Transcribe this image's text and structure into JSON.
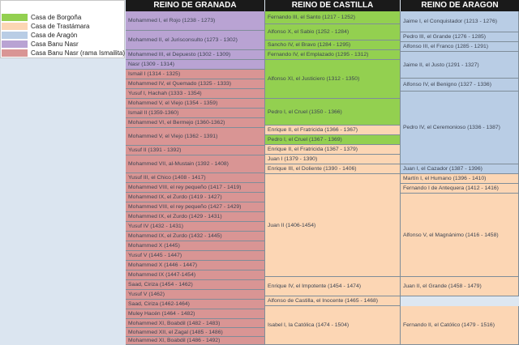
{
  "colors": {
    "borgona": "#93d050",
    "trastamara": "#fcd6b4",
    "aragon": "#b9cde5",
    "banu_nasr": "#b9a3d3",
    "banu_nasr_ismail": "#d99594"
  },
  "legend": [
    {
      "label": "Casa de Borgoña",
      "color": "#93d050"
    },
    {
      "label": "Casa de Trastámara",
      "color": "#fcd6b4"
    },
    {
      "label": "Casa de Aragón",
      "color": "#b9cde5"
    },
    {
      "label": "Casa Banu Nasr",
      "color": "#b9a3d3"
    },
    {
      "label": "Casa Banu Nasr (rama Ismailita)",
      "color": "#d99594"
    }
  ],
  "headers": {
    "granada": "REINO DE GRANADA",
    "castilla": "REINO DE CASTILLA",
    "aragon": "REINO DE ARAGON"
  },
  "granada": [
    "Mohammed I, el Rojo (1238 - 1273)",
    "Mohammed II, el Jurisconsulto (1273 - 1302)",
    "Mohammed III, el Depuesto (1302 - 1309)",
    "Nasr (1309 - 1314)",
    "Ismail I (1314 - 1325)",
    "Mohammed IV, el Quemado (1325 - 1333)",
    "Yusuf I, Hachah (1333 - 1354)",
    "Mohammed V, el Viejo (1354 - 1359)",
    "Ismail II (1359-1360)",
    "Mohammed VI, el Bermejo (1360-1362)",
    "Mohammed V, el Viejo (1362 - 1391)",
    "Yusuf II (1391 - 1392)",
    "Mohammed VII, al-Mustain (1392 - 1408)",
    "Yusuf III, el Chico (1408 - 1417)",
    "Mohammed VIII, el rey pequeño (1417 - 1419)",
    "Mohammed IX, el Zurdo (1419 - 1427)",
    "Mohammed VIII, el rey pequeño (1427 - 1429)",
    "Mohammed IX, el Zurdo (1429 - 1431)",
    "Yusuf IV (1432 - 1431)",
    "Mohammed IX, el Zurdo (1432 - 1445)",
    "Mohammed X (1445)",
    "Yusuf V (1445 - 1447)",
    "Mohammed X (1446 - 1447)",
    "Mohammed IX (1447-1454)",
    "Saad, Ciriza (1454 - 1462)",
    "Yusuf V (1462)",
    "Saad, Ciriza (1462-1464)",
    "Muley Hacén (1464 - 1482)",
    "Mohammed XI, Boabdil (1482 - 1483)",
    "Mohammed XII, el Zagal (1485 - 1486)",
    "Mohammed XI, Boabdil (1486 - 1492)"
  ],
  "castilla": [
    "Fernando III, el Santo (1217 - 1252)",
    "Alfonso X, el Sabio (1252 - 1284)",
    "Sancho IV, el Bravo (1284 - 1295)",
    "Fernando IV, el Emplazado (1295 - 1312)",
    "Alfonso XI, el Justiciero (1312 - 1350)",
    "Pedro I, el Cruel (1350 - 1366)",
    "Enrique II, el Fratricida (1366 - 1367)",
    "Pedro I, el Cruel (1367 - 1369)",
    "Enrique II, el Fratricida (1367 - 1379)",
    "Juan I (1379 - 1390)",
    "Enrique III, el Doliente (1390 - 1406)",
    "Juan II (1406-1454)",
    "Enrique IV, el Impotente (1454 - 1474)",
    "Alfonso de Castilla, el Inocente (1465 - 1468)",
    "Isabel I, la Católica (1474 - 1504)"
  ],
  "aragon": [
    "Jaime I, el Conquistador (1213 - 1276)",
    "Pedro III, el Grande (1276 - 1285)",
    "Alfonso III, el Franco (1285 - 1291)",
    "Jaime II, el Justo (1291 - 1327)",
    "Alfonso IV, el Benigno (1327 - 1336)",
    "Pedro IV, el Ceremonioso (1336 - 1387)",
    "Juan I, el Cazador (1387 - 1396)",
    "Martín I, el Humano (1396 - 1410)",
    "Fernando I de Antequera (1412 - 1416)",
    "Alfonso V, el Magnánimo (1416 - 1458)",
    "Juan II, el Grande (1458 - 1479)",
    "Fernando II, el Católico (1479 - 1516)"
  ]
}
